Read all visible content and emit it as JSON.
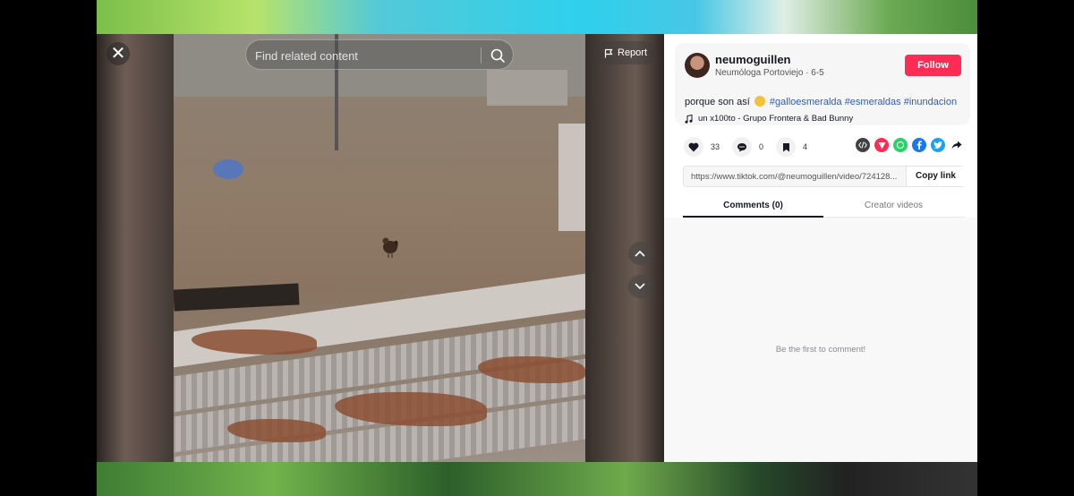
{
  "player": {
    "close_label": "✕",
    "search": {
      "placeholder": "Find related content"
    },
    "report_label": "Report"
  },
  "author": {
    "username": "neumoguillen",
    "nickname": "Neumóloga Portoviejo",
    "separator": " · ",
    "date": "6-5",
    "follow_label": "Follow"
  },
  "caption": {
    "text": "porque son así",
    "hashtags": [
      "#galloesmeralda",
      "#esmeraldas",
      "#inundacion"
    ]
  },
  "music": {
    "icon": "music-note-icon",
    "title": "un x100to - Grupo Frontera & Bad Bunny"
  },
  "stats": {
    "likes": "33",
    "comments": "0",
    "saves": "4"
  },
  "share_icons": [
    "embed-icon",
    "send-icon",
    "whatsapp-icon",
    "facebook-icon",
    "twitter-icon",
    "share-arrow-icon"
  ],
  "colors": {
    "accent": "#fe2c55",
    "hashtag": "#2b5db9",
    "whatsapp": "#25d366",
    "facebook": "#1877f2",
    "twitter": "#1da1f2",
    "embed": "#414141",
    "send": "#fe2c55"
  },
  "link": {
    "url": "https://www.tiktok.com/@neumoguillen/video/724128...",
    "copy_label": "Copy link"
  },
  "tabs": [
    {
      "label": "Comments (0)"
    },
    {
      "label": "Creator videos"
    }
  ],
  "comments": {
    "empty_text": "Be the first to comment!"
  }
}
